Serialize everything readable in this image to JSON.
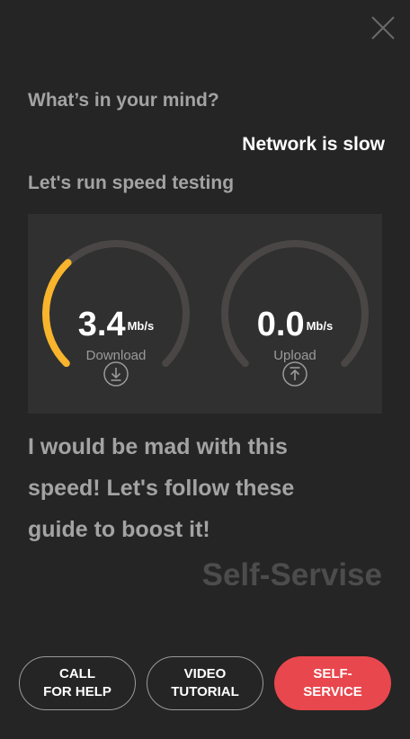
{
  "chat": {
    "prompt": "What’s in your mind?",
    "user_message": "Network is slow",
    "bot_message": "Let's run speed testing",
    "reaction": "I would be mad with this speed! Let's follow these guide to boost it!",
    "brand": "Self-Servise"
  },
  "speed_test": {
    "download": {
      "value": "3.4",
      "unit": "Mb/s",
      "label": "Download",
      "fill_fraction": 0.34,
      "icon": "download-icon"
    },
    "upload": {
      "value": "0.0",
      "unit": "Mb/s",
      "label": "Upload",
      "fill_fraction": 0.0,
      "icon": "upload-icon"
    }
  },
  "actions": {
    "call": "CALL\nFOR HELP",
    "video": "VIDEO\nTUTORIAL",
    "self": "SELF-\nSERVICE"
  },
  "colors": {
    "background": "#252525",
    "panel": "#303030",
    "gauge_track": "#4a4646",
    "gauge_fill": "#f7b42c",
    "primary_button": "#e8474d"
  }
}
